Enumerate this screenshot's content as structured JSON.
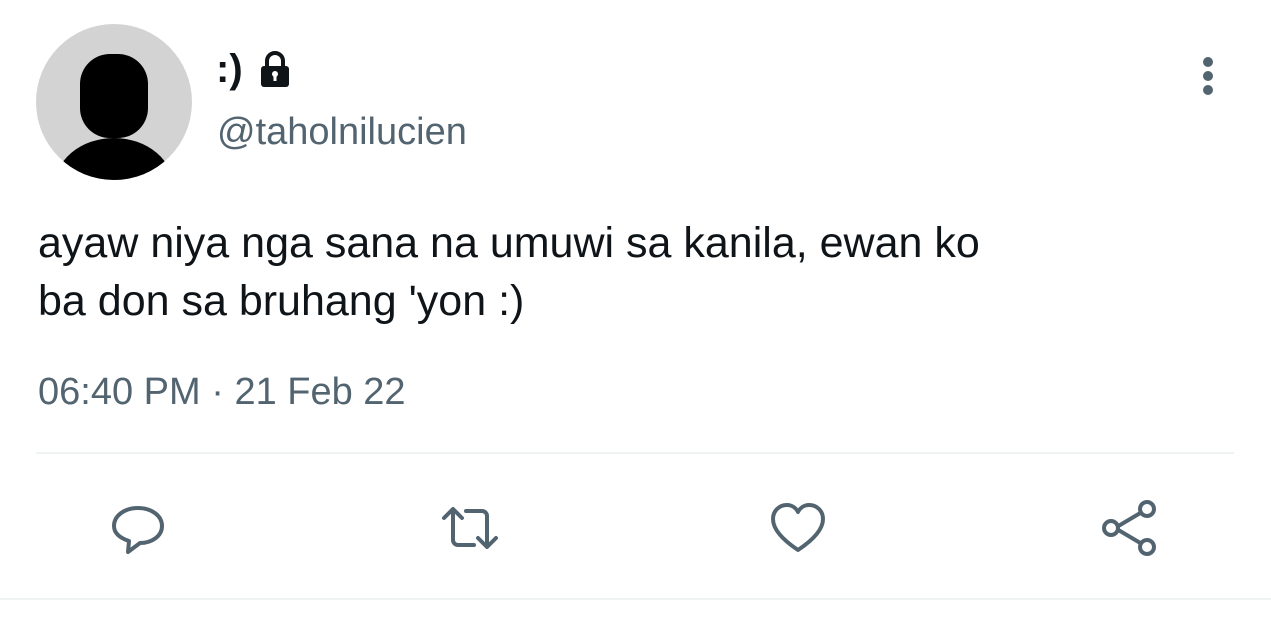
{
  "tweet": {
    "display_name": ":)",
    "handle": "@taholnilucien",
    "protected": true,
    "text": "ayaw niya nga sana na umuwi sa kanila, ewan ko\nba don sa bruhang 'yon :)",
    "time": "06:40 PM",
    "separator": "·",
    "date": "21 Feb 22"
  },
  "icons": {
    "avatar": "default-avatar-silhouette",
    "protected": "lock-icon",
    "more": "more-vertical-icon",
    "reply": "reply-icon",
    "retweet": "retweet-icon",
    "like": "heart-icon",
    "share": "share-icon"
  },
  "colors": {
    "text_primary": "#0f1419",
    "text_secondary": "#536471",
    "divider": "#eff3f4",
    "avatar_bg": "#d3d3d3"
  }
}
